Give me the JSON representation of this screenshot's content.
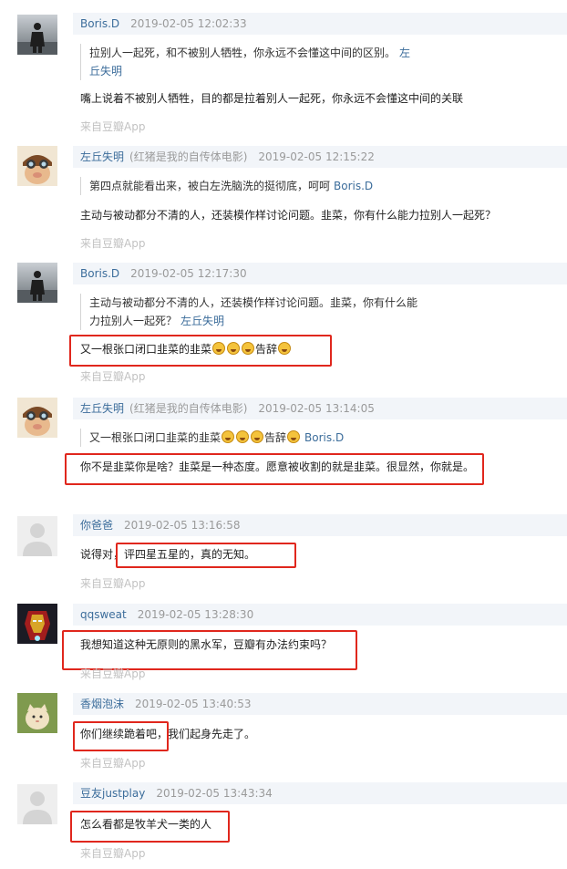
{
  "source_label": "来自豆瓣App",
  "comments": [
    {
      "author": "Boris.D",
      "extra": "",
      "time": "2019-02-05 12:02:33",
      "quote_text": "拉别人一起死，和不被别人牺牲，你永远不会懂这中间的区别。",
      "quote_author": "左丘失明",
      "body": "嘴上说着不被别人牺牲，目的都是拉着别人一起死，你永远不会懂这中间的关联"
    },
    {
      "author": "左丘失明",
      "extra": "(红猪是我的自传体电影)",
      "time": "2019-02-05 12:15:22",
      "quote_text": "第四点就能看出来，被白左洗脑洗的挺彻底，呵呵",
      "quote_author": "Boris.D",
      "body": "主动与被动都分不清的人，还装模作样讨论问题。韭菜，你有什么能力拉别人一起死？"
    },
    {
      "author": "Boris.D",
      "extra": "",
      "time": "2019-02-05 12:17:30",
      "quote_line1": "主动与被动都分不清的人，还装模作样讨论问题。韭菜，你有什么能",
      "quote_line2": "力拉别人一起死？",
      "quote_author": "左丘失明",
      "body": "又一根张口闭口韭菜的韭菜",
      "body_tail": "告辞"
    },
    {
      "author": "左丘失明",
      "extra": "(红猪是我的自传体电影)",
      "time": "2019-02-05 13:14:05",
      "quote_text": "又一根张口闭口韭菜的韭菜",
      "quote_tail": "告辞",
      "quote_author": "Boris.D",
      "body": "你不是韭菜你是啥？韭菜是一种态度。愿意被收割的就是韭菜。很显然，你就是。"
    },
    {
      "author": "你爸爸",
      "extra": "",
      "time": "2019-02-05 13:16:58",
      "body": "说得对，评四星五星的，真的无知。"
    },
    {
      "author": "qqsweat",
      "extra": "",
      "time": "2019-02-05 13:28:30",
      "body": "我想知道这种无原则的黑水军，豆瓣有办法约束吗？"
    },
    {
      "author": "香烟泡沫",
      "extra": "",
      "time": "2019-02-05 13:40:53",
      "body": "你们继续跪着吧，我们起身先走了。"
    },
    {
      "author": "豆友justplay",
      "extra": "",
      "time": "2019-02-05 13:43:34",
      "body": "怎么看都是牧羊犬一类的人"
    }
  ],
  "colors": {
    "author": "#3c6d9b",
    "meta_bg": "#f2f5f9",
    "highlight": "#e0271d",
    "muted": "#9a9a9a"
  }
}
